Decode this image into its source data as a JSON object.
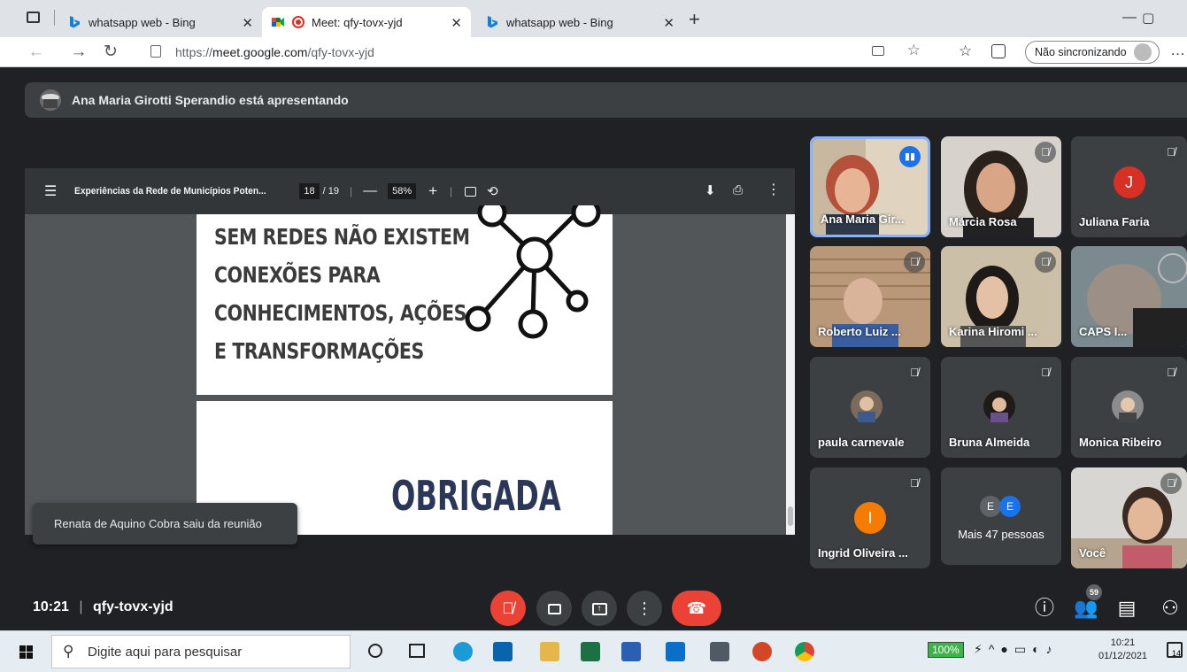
{
  "browser": {
    "tabs": [
      {
        "label": "whatsapp web - Bing",
        "icon": "bing-icon",
        "active": false
      },
      {
        "label": "Meet: qfy-tovx-yjd",
        "icon": "meet-icon",
        "active": true
      },
      {
        "label": "whatsapp web - Bing",
        "icon": "bing-icon",
        "active": false
      }
    ],
    "url_prefix": "https://",
    "url_domain": "meet.google.com",
    "url_path": "/qfy-tovx-yjd",
    "sync_label": "Não sincronizando"
  },
  "meet": {
    "presenting_text": "Ana Maria Girotti Sperandio está apresentando",
    "pdf": {
      "title": "Experiências da Rede de Municípios Poten...",
      "page_current": "18",
      "page_total": "/ 19",
      "zoom": "58%"
    },
    "slide1_lines": [
      "SEM REDES NÃO EXISTEM",
      "CONEXÕES PARA",
      "CONHECIMENTOS, AÇÕES",
      "E TRANSFORMAÇÕES"
    ],
    "slide2_text": "OBRIGADA",
    "toast": "Renata de Aquino Cobra saiu da reunião",
    "participants": [
      {
        "name": "Ana Maria Gir...",
        "type": "photo",
        "speaking": true
      },
      {
        "name": "Márcia Rosa",
        "type": "photo",
        "muted": true
      },
      {
        "name": "Juliana Faria",
        "type": "avatar",
        "initial": "J",
        "color": "#d93025",
        "muted": true
      },
      {
        "name": "Roberto Luiz ...",
        "type": "photo",
        "muted": true
      },
      {
        "name": "Karina Hiromi ...",
        "type": "photo",
        "muted": true
      },
      {
        "name": "CAPS I...",
        "type": "photo"
      },
      {
        "name": "paula carnevale",
        "type": "photo-avatar",
        "muted": true
      },
      {
        "name": "Bruna Almeida",
        "type": "photo-avatar",
        "muted": true
      },
      {
        "name": "Monica Ribeiro",
        "type": "photo-avatar",
        "muted": true
      },
      {
        "name": "Ingrid Oliveira ...",
        "type": "avatar",
        "initial": "I",
        "color": "#f57c00",
        "muted": true
      },
      {
        "name": "Mais 47 pessoas",
        "type": "more",
        "initials": [
          "E",
          "E"
        ]
      },
      {
        "name": "Você",
        "type": "photo",
        "muted": true
      }
    ],
    "time": "10:21",
    "meeting_code": "qfy-tovx-yjd",
    "participant_count": "59"
  },
  "taskbar": {
    "search_placeholder": "Digite aqui para pesquisar",
    "battery": "100%",
    "time": "10:21",
    "date": "01/12/2021",
    "notif_count": "14"
  }
}
